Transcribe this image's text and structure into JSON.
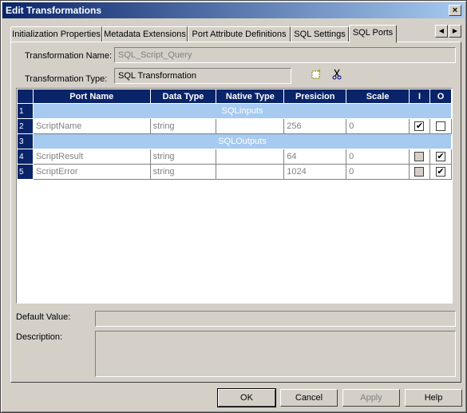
{
  "window": {
    "title": "Edit Transformations",
    "close": "×"
  },
  "tabs": [
    {
      "label": "Initialization Properties"
    },
    {
      "label": "Metadata Extensions"
    },
    {
      "label": "Port Attribute Definitions"
    },
    {
      "label": "SQL Settings"
    },
    {
      "label": "SQL Ports"
    }
  ],
  "tab_scroll": {
    "left": "◀",
    "right": "▶"
  },
  "form": {
    "name_label": "Transformation Name:",
    "name_value": "SQL_Script_Query",
    "type_label": "Transformation Type:",
    "type_value": "SQL Transformation",
    "new_icon": "new-port-icon",
    "cut_icon": "scissors-icon",
    "default_label": "Default Value:",
    "description_label": "Description:"
  },
  "grid": {
    "columns": [
      "Port Name",
      "Data Type",
      "Native Type",
      "Presicion",
      "Scale",
      "I",
      "O"
    ],
    "rows": [
      {
        "num": "1",
        "group": "SQLInputs"
      },
      {
        "num": "2",
        "name": "ScriptName",
        "dtype": "string",
        "native": "",
        "precision": "256",
        "scale": "0",
        "i": "✔",
        "o": ""
      },
      {
        "num": "3",
        "group": "SQLOutputs"
      },
      {
        "num": "4",
        "name": "ScriptResult",
        "dtype": "string",
        "native": "",
        "precision": "64",
        "scale": "0",
        "i": "",
        "o": "✔"
      },
      {
        "num": "5",
        "name": "ScriptError",
        "dtype": "string",
        "native": "",
        "precision": "1024",
        "scale": "0",
        "i": "",
        "o": "✔"
      }
    ]
  },
  "buttons": {
    "ok": "OK",
    "cancel": "Cancel",
    "apply": "Apply",
    "help": "Help"
  }
}
